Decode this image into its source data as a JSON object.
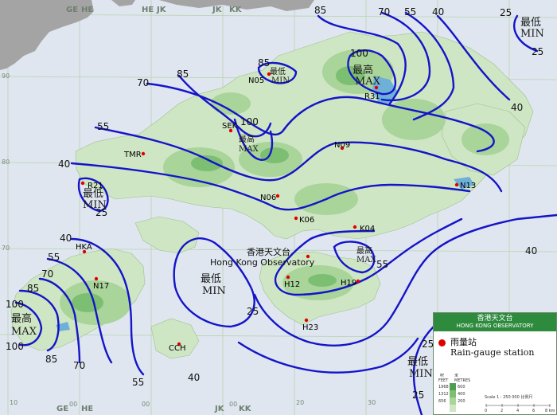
{
  "map": {
    "sheet_codes": {
      "top": [
        "GE",
        "HE",
        "HE",
        "JK",
        "JK",
        "KK"
      ],
      "bottom": [
        "GE",
        "HE",
        "JK",
        "KK"
      ],
      "bottom_numbers": [
        "00",
        "00",
        "00"
      ]
    },
    "grid_labels": {
      "left": [
        "90",
        "80",
        "70"
      ],
      "bottom": [
        "10",
        "20",
        "30",
        "40"
      ]
    },
    "isohyet_labels": [
      {
        "text": "85"
      },
      {
        "text": "70"
      },
      {
        "text": "55"
      },
      {
        "text": "40"
      },
      {
        "text": "25"
      },
      {
        "text": "25"
      },
      {
        "text": "40"
      },
      {
        "text": "100"
      },
      {
        "text": "70"
      },
      {
        "text": "85"
      },
      {
        "text": "85"
      },
      {
        "text": "100"
      },
      {
        "text": "55"
      },
      {
        "text": "40"
      },
      {
        "text": "25"
      },
      {
        "text": "40"
      },
      {
        "text": "55"
      },
      {
        "text": "70"
      },
      {
        "text": "85"
      },
      {
        "text": "100"
      },
      {
        "text": "100"
      },
      {
        "text": "85"
      },
      {
        "text": "70"
      },
      {
        "text": "55"
      },
      {
        "text": "40"
      },
      {
        "text": "25"
      },
      {
        "text": "55"
      },
      {
        "text": "40"
      },
      {
        "text": "25"
      },
      {
        "text": "25"
      }
    ],
    "extremes": [
      {
        "zh": "最低",
        "en": "MIN"
      },
      {
        "zh": "最高",
        "en": "MAX"
      },
      {
        "zh": "最低",
        "en": "MIN"
      },
      {
        "zh": "最高",
        "en": "MAX"
      },
      {
        "zh": "最低",
        "en": "MIN"
      },
      {
        "zh": "最低",
        "en": "MIN"
      },
      {
        "zh": "最高",
        "en": "MAX"
      },
      {
        "zh": "最高",
        "en": "MAX"
      },
      {
        "zh": "最低",
        "en": "MIN"
      }
    ],
    "stations": [
      "N05",
      "R31",
      "SEK",
      "N09",
      "TMR",
      "R21",
      "N13",
      "N06",
      "K06",
      "K04",
      "HKA",
      "N17",
      "H12",
      "H19",
      "H23",
      "CCH"
    ],
    "observatory": {
      "zh": "香港天文台",
      "en": "Hong Kong Observatory"
    }
  },
  "legend": {
    "title_zh": "香港天文台",
    "title_en": "HONG KONG OBSERVATORY",
    "station_zh": "雨量站",
    "station_en": "Rain-gauge station",
    "elevation_feet_label": "FEET",
    "elevation_metres_label": "METRES",
    "elevation_zh_feet": "呎",
    "elevation_zh_metres": "米",
    "elevation_feet": [
      "1968",
      "1312",
      "656"
    ],
    "elevation_metres": [
      "600",
      "400",
      "200"
    ],
    "scale": "Scale 1 : 250 000  比例尺",
    "scale_ticks": [
      "0",
      "2",
      "4",
      "6",
      "8 km"
    ]
  },
  "colors": {
    "sea": "#dfe6ef",
    "land_low": "#cfe6c4",
    "land_mid": "#a9d49a",
    "land_high": "#7dbf72",
    "mainland": "#a4a4a4",
    "isohyet": "#1414c8",
    "station": "#e00000",
    "legend_header": "#2e8b3e"
  }
}
